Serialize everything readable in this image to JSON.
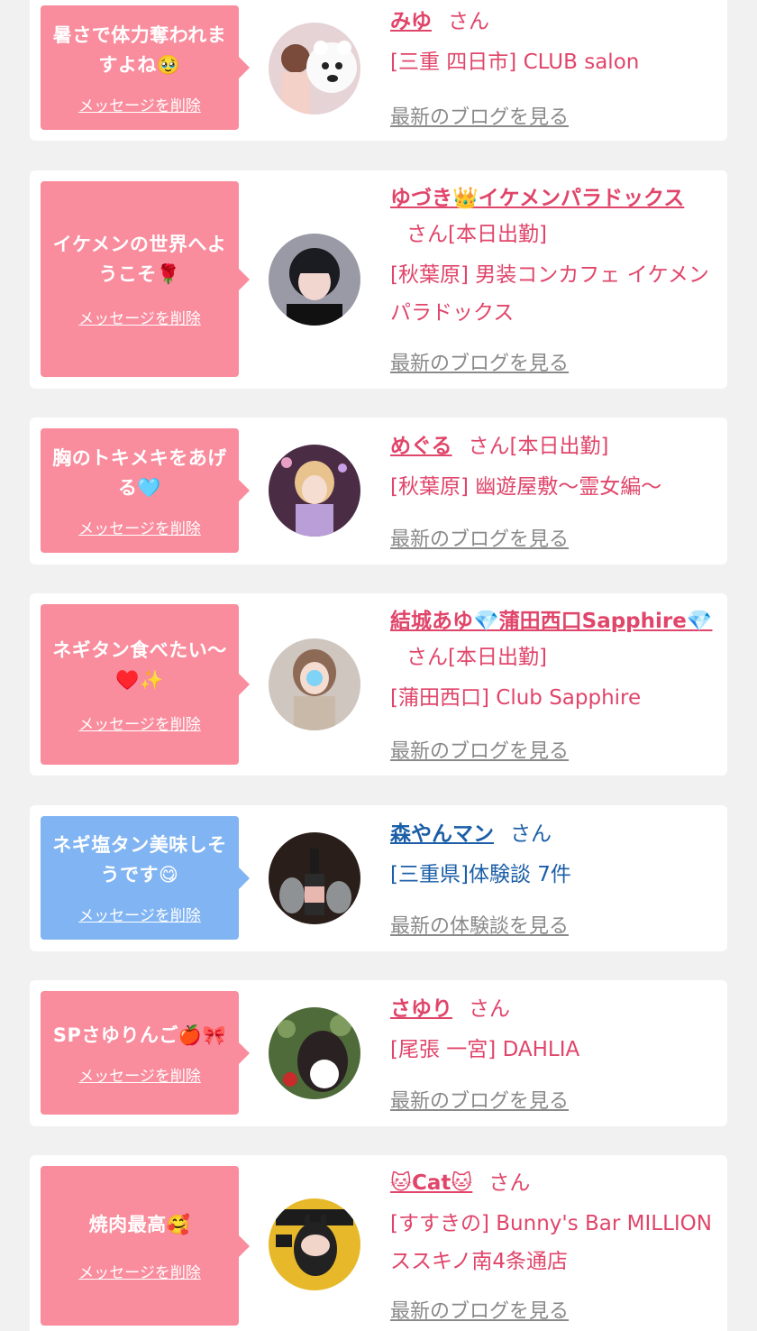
{
  "colors": {
    "pink": "#f98c9d",
    "blue_bubble": "#80b4f2",
    "name_pink": "#e0456a",
    "name_blue": "#1c5fa7",
    "link_gray": "#8a8a8a"
  },
  "cards": [
    {
      "bubble_text": "暑さで体力奪われますよね🥹",
      "delete_label": "メッセージを削除",
      "name": "みゆ",
      "suffix": "さん",
      "place": "[三重 四日市] CLUB salon",
      "blog_label": "最新のブログを見る"
    },
    {
      "bubble_text": "イケメンの世界へようこそ🌹",
      "delete_label": "メッセージを削除",
      "name": "ゆづき👑イケメンパラドックス",
      "suffix": "さん[本日出勤]",
      "place": "[秋葉原] 男装コンカフェ イケメンパラドックス",
      "blog_label": "最新のブログを見る"
    },
    {
      "bubble_text": "胸のトキメキをあげる🩵",
      "delete_label": "メッセージを削除",
      "name": "めぐる",
      "suffix": "さん[本日出勤]",
      "place": "[秋葉原] 幽遊屋敷〜霊女編〜",
      "blog_label": "最新のブログを見る"
    },
    {
      "bubble_text": "ネギタン食べたい〜♥️✨",
      "delete_label": "メッセージを削除",
      "name": "結城あゆ💎蒲田西口Sapphire💎",
      "suffix": "さん[本日出勤]",
      "place": "[蒲田西口] Club Sapphire",
      "blog_label": "最新のブログを見る"
    },
    {
      "bubble_text": "ネギ塩タン美味しそうです😋",
      "delete_label": "メッセージを削除",
      "name": "森やんマン",
      "suffix": "さん",
      "place": "[三重県]体験談 7件",
      "blog_label": "最新の体験談を見る"
    },
    {
      "bubble_text": "SPさゆりんご🍎🎀",
      "delete_label": "メッセージを削除",
      "name": "さゆり",
      "suffix": "さん",
      "place": "[尾張 一宮] DAHLIA",
      "blog_label": "最新のブログを見る"
    },
    {
      "bubble_text": "焼肉最高🥰",
      "delete_label": "メッセージを削除",
      "name": "🐱Cat🐱",
      "suffix": "さん",
      "place": "[すすきの] Bunny's Bar MILLION ススキノ南4条通店",
      "blog_label": "最新のブログを見る"
    }
  ]
}
